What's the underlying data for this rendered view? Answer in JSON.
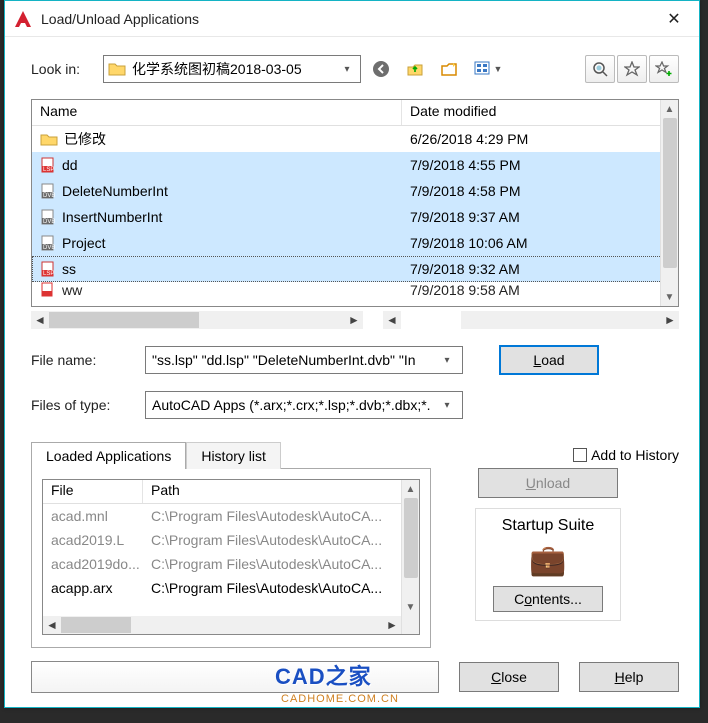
{
  "window": {
    "title": "Load/Unload Applications"
  },
  "lookin": {
    "label": "Look in:",
    "path": "化学系统图初稿2018-03-05"
  },
  "columns": {
    "name": "Name",
    "date": "Date modified"
  },
  "files": [
    {
      "icon": "folder",
      "name": "已修改",
      "date": "6/26/2018 4:29 PM",
      "sel": false
    },
    {
      "icon": "lsp",
      "name": "dd",
      "date": "7/9/2018 4:55 PM",
      "sel": true
    },
    {
      "icon": "dvb",
      "name": "DeleteNumberInt",
      "date": "7/9/2018 4:58 PM",
      "sel": true
    },
    {
      "icon": "dvb",
      "name": "InsertNumberInt",
      "date": "7/9/2018 9:37 AM",
      "sel": true
    },
    {
      "icon": "dvb",
      "name": "Project",
      "date": "7/9/2018 10:06 AM",
      "sel": true
    },
    {
      "icon": "lsp",
      "name": "ss",
      "date": "7/9/2018 9:32 AM",
      "sel": true,
      "focus": true
    }
  ],
  "partial": {
    "name": "ww",
    "date": "7/9/2018 9:58 AM"
  },
  "filename": {
    "label": "File name:",
    "value": "\"ss.lsp\" \"dd.lsp\" \"DeleteNumberInt.dvb\" \"In"
  },
  "filetype": {
    "label": "Files of type:",
    "value": "AutoCAD Apps (*.arx;*.crx;*.lsp;*.dvb;*.dbx;*."
  },
  "buttons": {
    "load": "Load",
    "unload": "Unload",
    "close": "Close",
    "help": "Help",
    "contents": "Contents..."
  },
  "tabs": {
    "loaded": "Loaded Applications",
    "history": "History list"
  },
  "addhistory": "Add to History",
  "loaded_cols": {
    "file": "File",
    "path": "Path"
  },
  "loaded_rows": [
    {
      "file": "acad.mnl",
      "path": "C:\\Program Files\\Autodesk\\AutoCA...",
      "gray": true
    },
    {
      "file": "acad2019.L",
      "path": "C:\\Program Files\\Autodesk\\AutoCA...",
      "gray": true
    },
    {
      "file": "acad2019do...",
      "path": "C:\\Program Files\\Autodesk\\AutoCA...",
      "gray": true
    },
    {
      "file": "acapp.arx",
      "path": "C:\\Program Files\\Autodesk\\AutoCA...",
      "gray": false
    }
  ],
  "startup": "Startup Suite",
  "watermark": {
    "t1": "CAD之家",
    "t2": "CADHOME.COM.CN"
  }
}
